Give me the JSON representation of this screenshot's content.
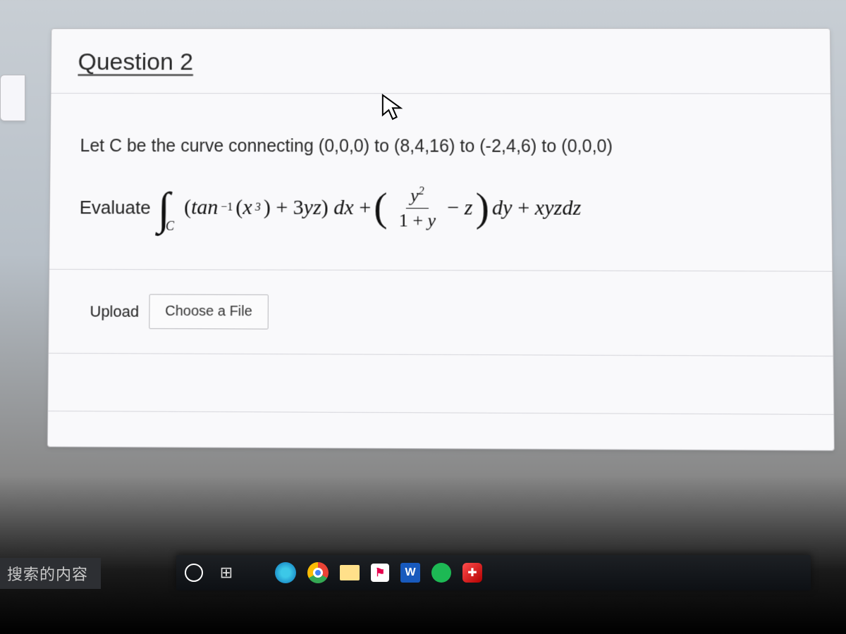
{
  "question": {
    "title": "Question 2",
    "curve_text": "Let C be the curve connecting (0,0,0) to (8,4,16) to (-2,4,6) to (0,0,0)",
    "evaluate_label": "Evaluate",
    "integral_expression": {
      "sym": "∫",
      "sub": "C",
      "p1_a": "(tan",
      "p1_sup": "−1",
      "p1_b": "(x",
      "p1_sup2": "3",
      "p1_c": ") + 3yz) dx + ",
      "frac_num_a": "y",
      "frac_num_sup": "2",
      "frac_den": "1 + y",
      "p2_a": " − z",
      "p3": " dy + xyzdz"
    }
  },
  "upload": {
    "label": "Upload",
    "button": "Choose a File"
  },
  "search_placeholder": "搜索的内容",
  "taskbar": {
    "taskview": "⊞",
    "word": "W",
    "store": "⚑"
  }
}
